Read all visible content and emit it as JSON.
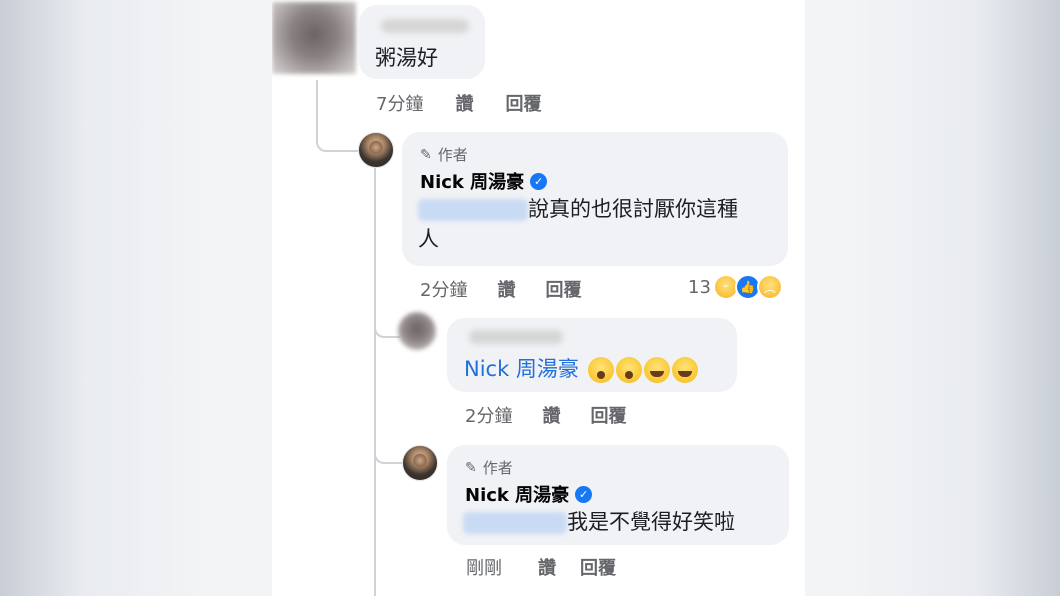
{
  "comment1": {
    "text": "粥湯好",
    "time": "7分鐘",
    "like": "讚",
    "reply": "回覆"
  },
  "reply1": {
    "author_badge": "作者",
    "name": "Nick 周湯豪",
    "text": "說真的也很討厭你這種",
    "text2": "人",
    "time": "2分鐘",
    "like": "讚",
    "reply": "回覆",
    "reaction_count": "13"
  },
  "reply2": {
    "mention": "Nick 周湯豪",
    "time": "2分鐘",
    "like": "讚",
    "reply": "回覆"
  },
  "reply3": {
    "author_badge": "作者",
    "name": "Nick 周湯豪",
    "text": "我是不覺得好笑啦",
    "time": "剛剛",
    "like": "讚",
    "reply": "回覆"
  },
  "icons": {
    "pen": "pencil-icon",
    "verified": "verified-badge-icon",
    "reactions": [
      "haha",
      "like",
      "sad"
    ],
    "emojis": [
      "shocked-face",
      "shocked-face",
      "rolling-laughing",
      "rolling-laughing"
    ]
  },
  "colors": {
    "bubble": "#f0f2f5",
    "link": "#216fdb",
    "meta": "#65676b",
    "verified": "#1877f2"
  }
}
